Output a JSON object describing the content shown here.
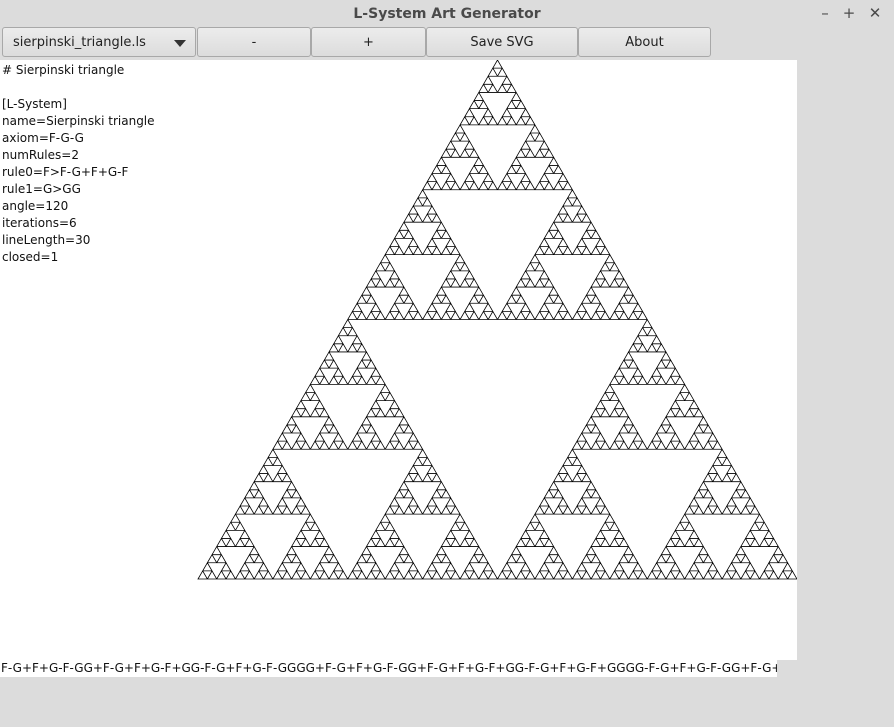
{
  "window": {
    "title": "L-System Art Generator",
    "controls": {
      "minimize": "–",
      "maximize": "+",
      "close": "✕"
    }
  },
  "toolbar": {
    "file_select": "sierpinski_triangle.ls",
    "minus_label": "-",
    "plus_label": "+",
    "save_label": "Save SVG",
    "about_label": "About"
  },
  "config_lines": [
    "# Sierpinski triangle",
    "",
    "[L-System]",
    "name=Sierpinski triangle",
    "axiom=F-G-G",
    "numRules=2",
    "rule0=F>F-G+F+G-F",
    "rule1=G>GG",
    "angle=120",
    "iterations=6",
    "lineLength=30",
    "closed=1"
  ],
  "lsystem": {
    "axiom": "F-G-G",
    "angle": 120,
    "iterations": 6,
    "stroke_color": "#000000"
  },
  "status": {
    "lstring": "F-G+F+G-F-GG+F-G+F+G-F+GG-F-G+F+G-F-GGGG+F-G+F+G-F-GG+F-G+F+G-F+GG-F-G+F+G-F+GGGG-F-G+F+G-F-GG+F-G+F"
  }
}
